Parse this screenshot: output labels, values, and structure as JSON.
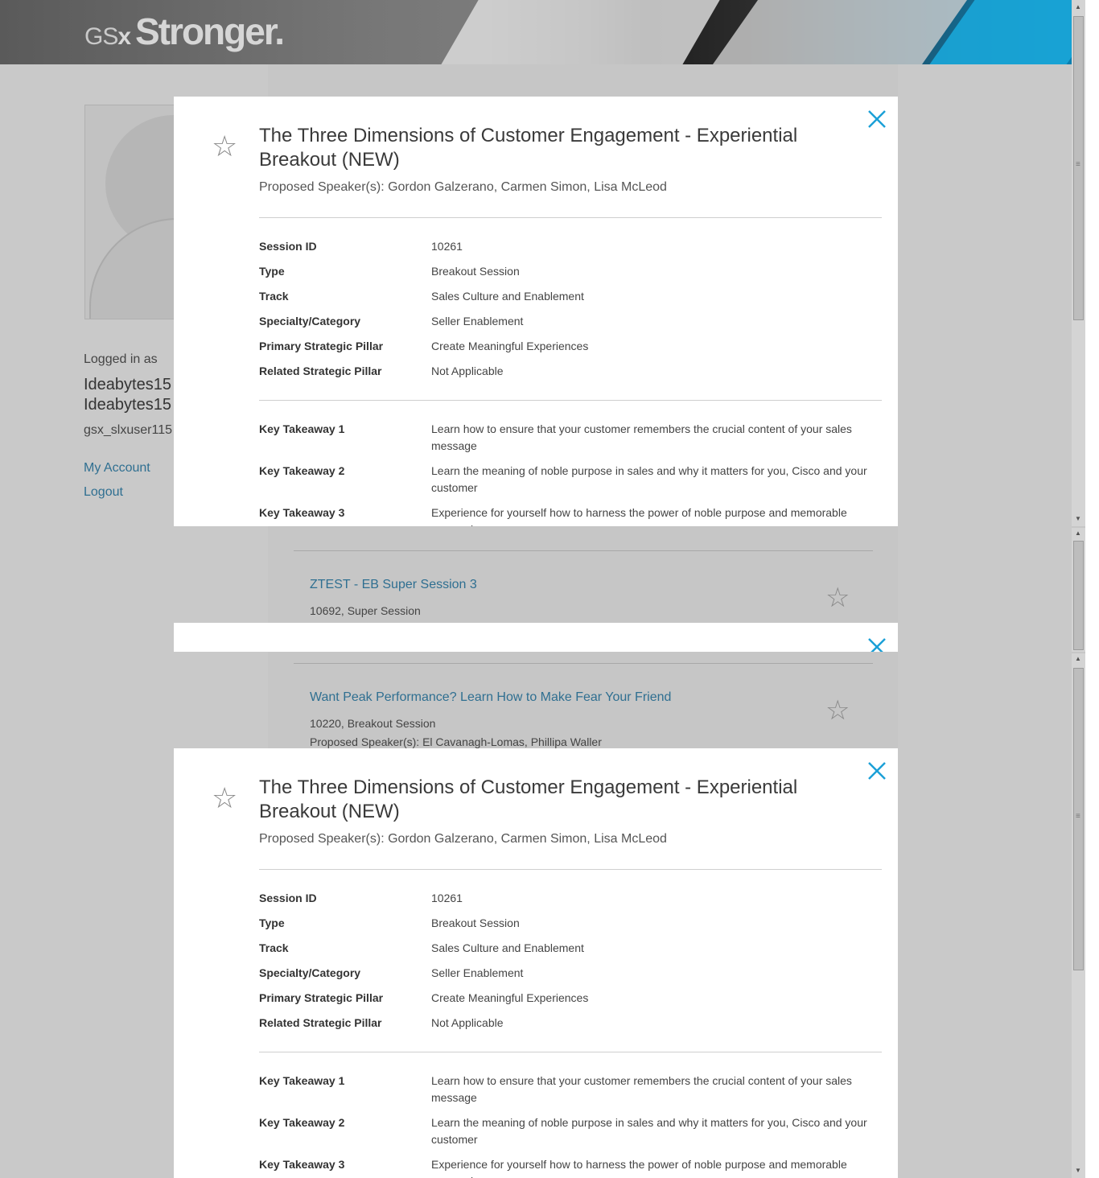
{
  "header": {
    "logo_prefix": "GS",
    "logo_x": "x",
    "logo_word": "Stronger."
  },
  "profile": {
    "logged_in_label": "Logged in as",
    "name_line1": "Ideabytes15",
    "name_line2": "Ideabytes15",
    "user_id": "gsx_slxuser115",
    "my_account": "My Account",
    "logout": "Logout"
  },
  "list": [
    {
      "title": "ZTEST - EB Super Session 3",
      "meta": "10692, Super Session",
      "speakers": ""
    },
    {
      "title": "Want Peak Performance? Learn How to Make Fear Your Friend",
      "meta": "10220, Breakout Session",
      "speakers": "Proposed Speaker(s): El Cavanagh-Lomas,  Phillipa Waller"
    }
  ],
  "modal": {
    "title": "The Three Dimensions of Customer Engagement - Experiential Breakout (NEW)",
    "speakers": "Proposed Speaker(s): Gordon Galzerano,  Carmen Simon,  Lisa McLeod",
    "fields": [
      {
        "label": "Session ID",
        "value": "10261"
      },
      {
        "label": "Type",
        "value": "Breakout Session"
      },
      {
        "label": "Track",
        "value": "Sales Culture and Enablement"
      },
      {
        "label": "Specialty/Category",
        "value": "Seller Enablement"
      },
      {
        "label": "Primary Strategic Pillar",
        "value": "Create Meaningful Experiences"
      },
      {
        "label": "Related Strategic Pillar",
        "value": "Not Applicable"
      }
    ],
    "takeaways": [
      {
        "label": "Key Takeaway 1",
        "value": "Learn how to ensure that your customer remembers the crucial content of your sales message"
      },
      {
        "label": "Key Takeaway 2",
        "value": "Learn the meaning of noble purpose in sales and why it matters for you, Cisco and your customer"
      },
      {
        "label": "Key Takeaway 3",
        "value": "Experience for yourself how to harness the power of noble purpose and memorable messaging"
      }
    ]
  },
  "colors": {
    "accent": "#1ba0d7",
    "link": "#2f6f91"
  }
}
